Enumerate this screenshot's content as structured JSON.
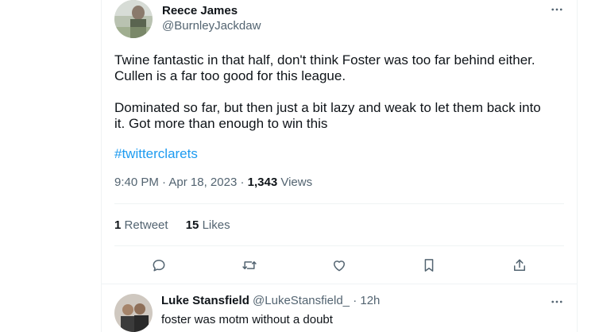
{
  "tweet": {
    "author_name": "Reece James",
    "author_handle": "@BurnleyJackdaw",
    "text_line1": "Twine fantastic in that half, don't think Foster was too far behind either.",
    "text_line2": "Cullen is a far too good for this league.",
    "text_line3": "Dominated so far, but then just a bit lazy and weak to let them back into",
    "text_line4": "it. Got more than enough to win this",
    "hashtag": "#twitterclarets",
    "time": "9:40 PM",
    "date": "Apr 18, 2023",
    "views_count": "1,343",
    "views_label": "Views",
    "retweets_count": "1",
    "retweets_label": "Retweet",
    "likes_count": "15",
    "likes_label": "Likes"
  },
  "reply": {
    "author_name": "Luke Stansfield",
    "author_handle": "@LukeStansfield_",
    "time_ago": "12h",
    "text": "foster was motm without a doubt"
  },
  "colors": {
    "accent": "#1d9bf0",
    "secondary_text": "#536471",
    "divider": "#eff3f4"
  },
  "icons": [
    "more-icon",
    "reply-icon",
    "retweet-icon",
    "like-icon",
    "bookmark-icon",
    "share-icon"
  ]
}
